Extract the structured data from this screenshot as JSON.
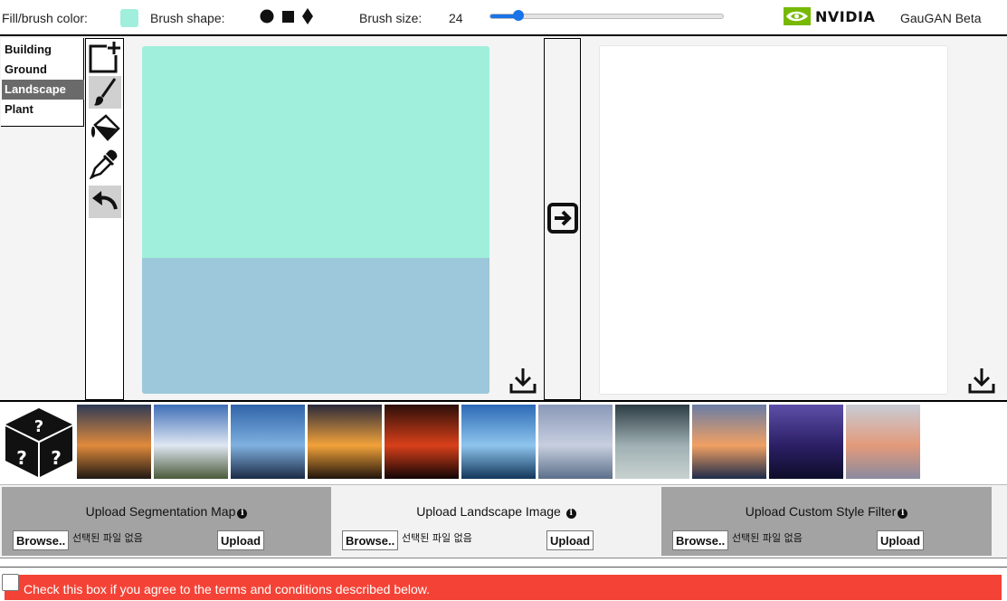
{
  "toolbar": {
    "fill_label": "Fill/brush color:",
    "fill_color": "#a0efdc",
    "shape_label": "Brush shape:",
    "shapes": [
      "circle-shape",
      "square-shape",
      "diamond-shape"
    ],
    "size_label": "Brush size:",
    "size_value": "24",
    "brand": "NVIDIA",
    "app_name": "GauGAN Beta"
  },
  "labels": {
    "items": [
      "Building",
      "Ground",
      "Landscape",
      "Plant"
    ],
    "selected": "Landscape"
  },
  "tools": [
    "new-canvas-icon",
    "brush-icon",
    "fill-bucket-icon",
    "eyedropper-icon",
    "undo-icon"
  ],
  "canvas": {
    "sky_color": "#a0efdc",
    "water_color": "#9dc7da",
    "download_icon": "download-icon"
  },
  "transform_icon": "arrow-right-icon",
  "output": {
    "download_icon": "download-icon"
  },
  "styles": {
    "random_icon": "random-dice-icon",
    "thumbnails": [
      {
        "a": "#2e3a55",
        "b": "#e08a3c",
        "c": "#201812"
      },
      {
        "a": "#3f6fb8",
        "b": "#dfe7f2",
        "c": "#4a5a3a"
      },
      {
        "a": "#2f63a9",
        "b": "#7fb1e0",
        "c": "#1b2a45"
      },
      {
        "a": "#2a2a3a",
        "b": "#f2a23a",
        "c": "#20140c"
      },
      {
        "a": "#2b0e08",
        "b": "#d9401a",
        "c": "#120505"
      },
      {
        "a": "#2c6ab5",
        "b": "#8ec5ee",
        "c": "#12365a"
      },
      {
        "a": "#8a98b8",
        "b": "#c7cfdf",
        "c": "#5b6f8a"
      },
      {
        "a": "#2c3c44",
        "b": "#9fb0b3",
        "c": "#c8d2d0"
      },
      {
        "a": "#6a7da6",
        "b": "#f1a063",
        "c": "#1e2b4a"
      },
      {
        "a": "#5d4fa8",
        "b": "#2c1f66",
        "c": "#0d0d2a"
      },
      {
        "a": "#c8ccd6",
        "b": "#e39a7a",
        "c": "#8a8aa0"
      }
    ]
  },
  "uploads": {
    "segmentation": {
      "title": "Upload Segmentation Map",
      "browse": "Browse..",
      "no_file": "선택된 파일 없음",
      "upload": "Upload"
    },
    "landscape": {
      "title": "Upload Landscape Image",
      "browse": "Browse..",
      "no_file": "선택된 파일 없음",
      "upload": "Upload"
    },
    "style": {
      "title": "Upload Custom Style Filter",
      "browse": "Browse..",
      "no_file": "선택된 파일 없음",
      "upload": "Upload"
    }
  },
  "terms": {
    "text": "Check this box if you agree to the terms and conditions described below.",
    "bar_color": "#f44336",
    "checked": false
  }
}
